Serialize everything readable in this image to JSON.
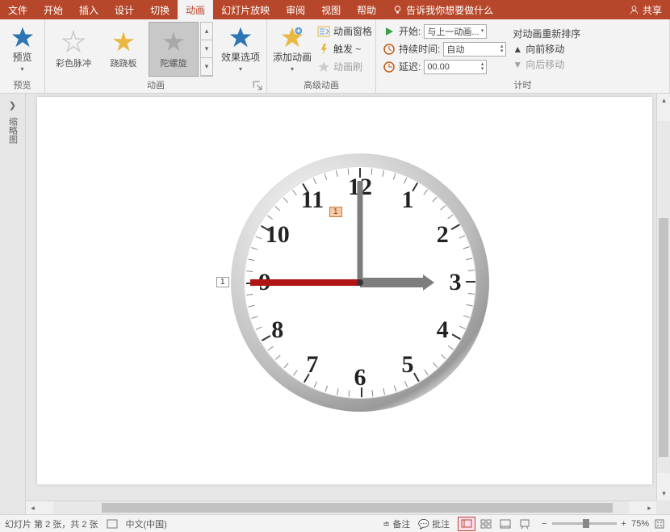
{
  "menu": {
    "file": "文件",
    "home": "开始",
    "insert": "插入",
    "design": "设计",
    "transition": "切换",
    "animation": "动画",
    "slideshow": "幻灯片放映",
    "review": "审阅",
    "view": "视图",
    "help": "帮助",
    "tell": "告诉我你想要做什么",
    "share": "共享"
  },
  "ribbon": {
    "preview": {
      "label": "预览",
      "group": "预览"
    },
    "anim_group": "动画",
    "anims": [
      "彩色脉冲",
      "跷跷板",
      "陀螺旋"
    ],
    "effect_options": "效果选项",
    "add_anim": "添加动画",
    "adv_group": "高级动画",
    "anim_pane": "动画窗格",
    "trigger": "触发 ~",
    "painter": "动画刷",
    "timing_group": "计时",
    "start_lbl": "开始:",
    "start_val": "与上一动画...",
    "duration_lbl": "持续时间:",
    "duration_val": "自动",
    "delay_lbl": "延迟:",
    "delay_val": "00.00",
    "reorder_hdr": "对动画重新排序",
    "move_earlier": "向前移动",
    "move_later": "向后移动"
  },
  "side": {
    "label": "缩略图"
  },
  "clock": {
    "numbers": [
      "12",
      "1",
      "2",
      "3",
      "4",
      "5",
      "6",
      "7",
      "8",
      "9",
      "10",
      "11"
    ],
    "tag1": "1",
    "tag2": "1"
  },
  "status": {
    "slide": "幻灯片 第 2 张，共 2 张",
    "lang": "中文(中国)",
    "notes": "备注",
    "comments": "批注",
    "zoom": "75%"
  }
}
